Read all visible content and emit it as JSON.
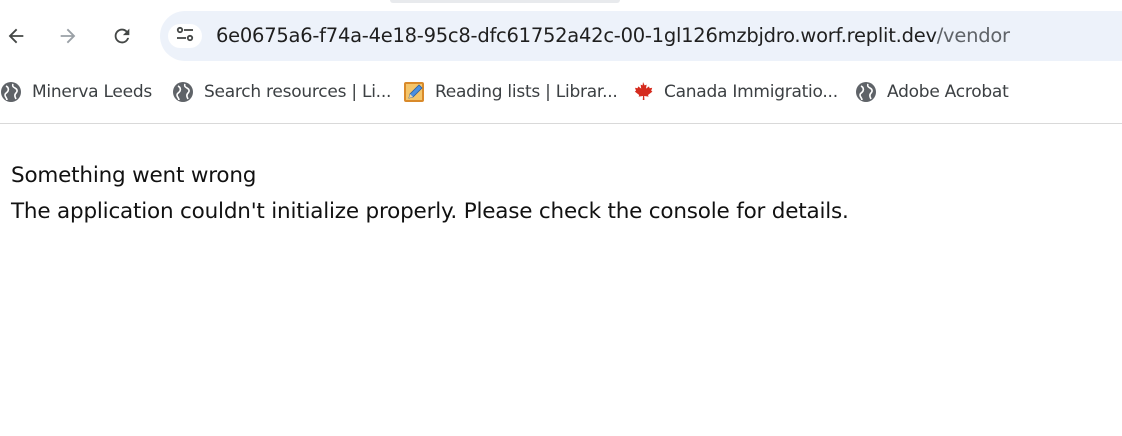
{
  "browser": {
    "address_bar": {
      "host": "6e0675a6-f74a-4e18-95c8-dfc61752a42c-00-1gl126mzbjdro.worf.replit.dev",
      "path": "/vendor"
    },
    "nav_icons": {
      "back": "arrow-left-icon",
      "forward": "arrow-right-icon",
      "reload": "reload-icon",
      "site_info": "tune-icon"
    },
    "bookmarks": [
      {
        "label": "Minerva Leeds",
        "icon": "globe-icon"
      },
      {
        "label": "Search resources | Li...",
        "icon": "globe-icon"
      },
      {
        "label": "Reading lists | Librar...",
        "icon": "pencil-notepad-icon"
      },
      {
        "label": "Canada Immigratio...",
        "icon": "maple-leaf-icon"
      },
      {
        "label": "Adobe Acrobat",
        "icon": "globe-icon"
      }
    ]
  },
  "page": {
    "error_title": "Something went wrong",
    "error_message": "The application couldn't initialize properly. Please check the console for details."
  }
}
